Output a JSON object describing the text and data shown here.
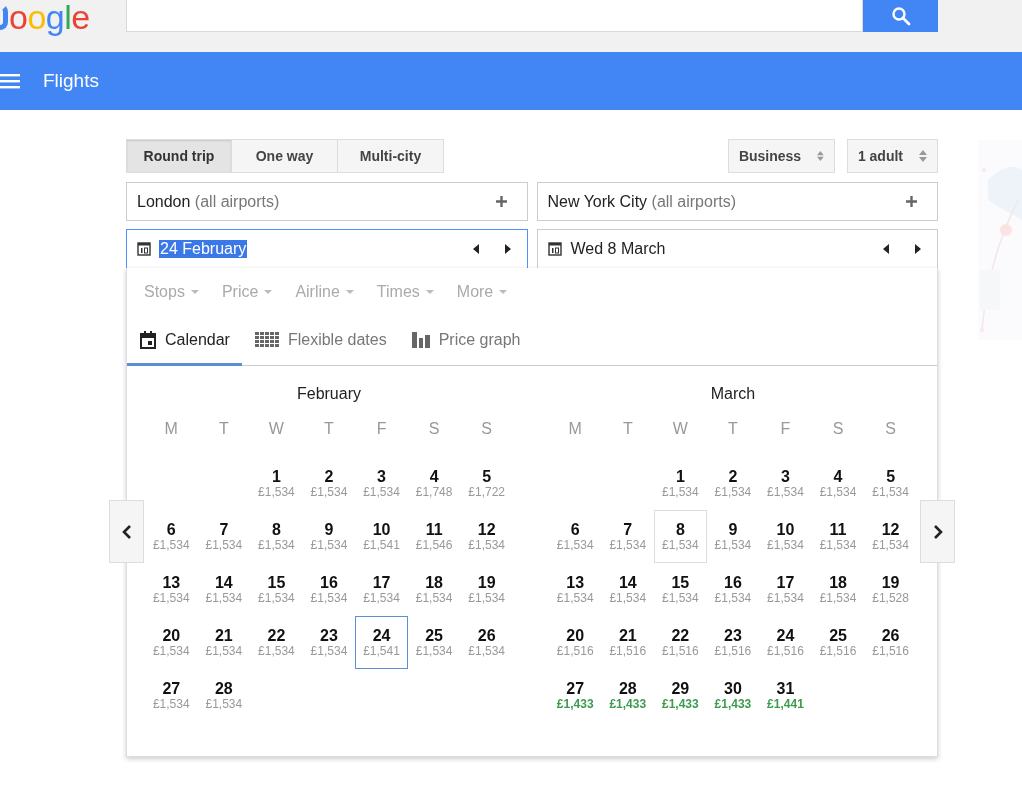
{
  "logo": {
    "text": "oogle"
  },
  "nav": {
    "title": "Flights"
  },
  "trip_types": [
    {
      "label": "Round trip",
      "selected": true
    },
    {
      "label": "One way",
      "selected": false
    },
    {
      "label": "Multi-city",
      "selected": false
    }
  ],
  "cabin": {
    "value": "Business"
  },
  "passengers": {
    "value": "1 adult"
  },
  "origin": {
    "city": "London",
    "note": "(all airports)"
  },
  "destination": {
    "city": "New York City",
    "note": "(all airports)"
  },
  "depart_date": {
    "value": "24 February",
    "text_selected": true
  },
  "return_date": {
    "value": "Wed 8 March",
    "text_selected": false
  },
  "filters": [
    {
      "label": "Stops"
    },
    {
      "label": "Price"
    },
    {
      "label": "Airline"
    },
    {
      "label": "Times"
    },
    {
      "label": "More"
    }
  ],
  "views": [
    {
      "label": "Calendar",
      "selected": true,
      "kind": "calendar"
    },
    {
      "label": "Flexible dates",
      "selected": false,
      "kind": "grid"
    },
    {
      "label": "Price graph",
      "selected": false,
      "kind": "bars"
    }
  ],
  "months": [
    {
      "name": "February",
      "kind": "depart",
      "weekdays": [
        "M",
        "T",
        "W",
        "T",
        "F",
        "S",
        "S"
      ],
      "weeks": [
        [
          {
            "day": "1",
            "price": "£1,534",
            "cheap": false,
            "selected": false
          },
          {
            "day": "2",
            "price": "£1,534",
            "cheap": false,
            "selected": false
          },
          {
            "day": "3",
            "price": "£1,534",
            "cheap": false,
            "selected": false
          },
          {
            "day": "4",
            "price": "£1,748",
            "cheap": false,
            "selected": false
          },
          {
            "day": "5",
            "price": "£1,722",
            "cheap": false,
            "selected": false
          }
        ],
        [
          {
            "day": "6",
            "price": "£1,534",
            "cheap": false,
            "selected": false
          },
          {
            "day": "7",
            "price": "£1,534",
            "cheap": false,
            "selected": false
          },
          {
            "day": "8",
            "price": "£1,534",
            "cheap": false,
            "selected": false
          },
          {
            "day": "9",
            "price": "£1,534",
            "cheap": false,
            "selected": false
          },
          {
            "day": "10",
            "price": "£1,541",
            "cheap": false,
            "selected": false
          },
          {
            "day": "11",
            "price": "£1,546",
            "cheap": false,
            "selected": false
          },
          {
            "day": "12",
            "price": "£1,534",
            "cheap": false,
            "selected": false
          }
        ],
        [
          {
            "day": "13",
            "price": "£1,534",
            "cheap": false,
            "selected": false
          },
          {
            "day": "14",
            "price": "£1,534",
            "cheap": false,
            "selected": false
          },
          {
            "day": "15",
            "price": "£1,534",
            "cheap": false,
            "selected": false
          },
          {
            "day": "16",
            "price": "£1,534",
            "cheap": false,
            "selected": false
          },
          {
            "day": "17",
            "price": "£1,534",
            "cheap": false,
            "selected": false
          },
          {
            "day": "18",
            "price": "£1,534",
            "cheap": false,
            "selected": false
          },
          {
            "day": "19",
            "price": "£1,534",
            "cheap": false,
            "selected": false
          }
        ],
        [
          {
            "day": "20",
            "price": "£1,534",
            "cheap": false,
            "selected": false
          },
          {
            "day": "21",
            "price": "£1,534",
            "cheap": false,
            "selected": false
          },
          {
            "day": "22",
            "price": "£1,534",
            "cheap": false,
            "selected": false
          },
          {
            "day": "23",
            "price": "£1,534",
            "cheap": false,
            "selected": false
          },
          {
            "day": "24",
            "price": "£1,541",
            "cheap": false,
            "selected": true
          },
          {
            "day": "25",
            "price": "£1,534",
            "cheap": false,
            "selected": false
          },
          {
            "day": "26",
            "price": "£1,534",
            "cheap": false,
            "selected": false
          }
        ],
        [
          {
            "day": "27",
            "price": "£1,534",
            "cheap": false,
            "selected": false
          },
          {
            "day": "28",
            "price": "£1,534",
            "cheap": false,
            "selected": false
          }
        ]
      ]
    },
    {
      "name": "March",
      "kind": "return",
      "weekdays": [
        "M",
        "T",
        "W",
        "T",
        "F",
        "S",
        "S"
      ],
      "weeks": [
        [
          {
            "day": "1",
            "price": "£1,534",
            "cheap": false,
            "selected": false
          },
          {
            "day": "2",
            "price": "£1,534",
            "cheap": false,
            "selected": false
          },
          {
            "day": "3",
            "price": "£1,534",
            "cheap": false,
            "selected": false
          },
          {
            "day": "4",
            "price": "£1,534",
            "cheap": false,
            "selected": false
          },
          {
            "day": "5",
            "price": "£1,534",
            "cheap": false,
            "selected": false
          }
        ],
        [
          {
            "day": "6",
            "price": "£1,534",
            "cheap": false,
            "selected": false
          },
          {
            "day": "7",
            "price": "£1,534",
            "cheap": false,
            "selected": false
          },
          {
            "day": "8",
            "price": "£1,534",
            "cheap": false,
            "selected": true
          },
          {
            "day": "9",
            "price": "£1,534",
            "cheap": false,
            "selected": false
          },
          {
            "day": "10",
            "price": "£1,534",
            "cheap": false,
            "selected": false
          },
          {
            "day": "11",
            "price": "£1,534",
            "cheap": false,
            "selected": false
          },
          {
            "day": "12",
            "price": "£1,534",
            "cheap": false,
            "selected": false
          }
        ],
        [
          {
            "day": "13",
            "price": "£1,534",
            "cheap": false,
            "selected": false
          },
          {
            "day": "14",
            "price": "£1,534",
            "cheap": false,
            "selected": false
          },
          {
            "day": "15",
            "price": "£1,534",
            "cheap": false,
            "selected": false
          },
          {
            "day": "16",
            "price": "£1,534",
            "cheap": false,
            "selected": false
          },
          {
            "day": "17",
            "price": "£1,534",
            "cheap": false,
            "selected": false
          },
          {
            "day": "18",
            "price": "£1,534",
            "cheap": false,
            "selected": false
          },
          {
            "day": "19",
            "price": "£1,528",
            "cheap": false,
            "selected": false
          }
        ],
        [
          {
            "day": "20",
            "price": "£1,516",
            "cheap": false,
            "selected": false
          },
          {
            "day": "21",
            "price": "£1,516",
            "cheap": false,
            "selected": false
          },
          {
            "day": "22",
            "price": "£1,516",
            "cheap": false,
            "selected": false
          },
          {
            "day": "23",
            "price": "£1,516",
            "cheap": false,
            "selected": false
          },
          {
            "day": "24",
            "price": "£1,516",
            "cheap": false,
            "selected": false
          },
          {
            "day": "25",
            "price": "£1,516",
            "cheap": false,
            "selected": false
          },
          {
            "day": "26",
            "price": "£1,516",
            "cheap": false,
            "selected": false
          }
        ],
        [
          {
            "day": "27",
            "price": "£1,433",
            "cheap": true,
            "selected": false
          },
          {
            "day": "28",
            "price": "£1,433",
            "cheap": true,
            "selected": false
          },
          {
            "day": "29",
            "price": "£1,433",
            "cheap": true,
            "selected": false
          },
          {
            "day": "30",
            "price": "£1,433",
            "cheap": true,
            "selected": false
          },
          {
            "day": "31",
            "price": "£1,441",
            "cheap": true,
            "selected": false
          }
        ]
      ]
    }
  ]
}
